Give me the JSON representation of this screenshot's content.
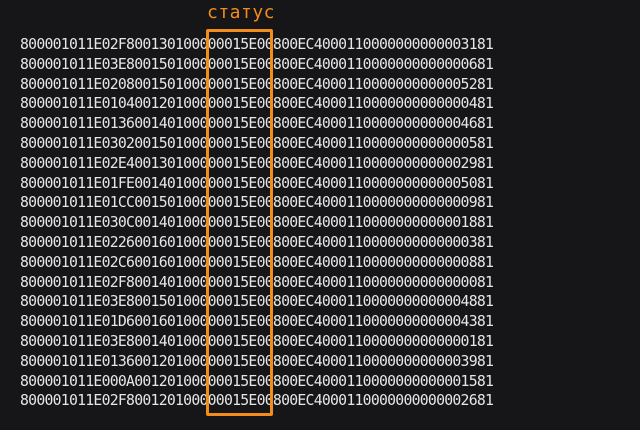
{
  "header": {
    "label": "статус"
  },
  "colors": {
    "background": "#161618",
    "text": "#e6e6e6",
    "accent": "#f28c1b"
  },
  "rows": [
    "800001011E02F800130100000015E00800EC4000110000000000003181",
    "800001011E03E800150100000015E00800EC4000110000000000000681",
    "800001011E020800150100000015E00800EC4000110000000000005281",
    "800001011E010400120100000015E00800EC4000110000000000000481",
    "800001011E013600140100000015E00800EC4000110000000000004681",
    "800001011E030200150100000015E00800EC4000110000000000000581",
    "800001011E02E400130100000015E00800EC4000110000000000002981",
    "800001011E01FE00140100000015E00800EC4000110000000000005081",
    "800001011E01CC00150100000015E00800EC4000110000000000000981",
    "800001011E030C00140100000015E00800EC4000110000000000001881",
    "800001011E022600160100000015E00800EC4000110000000000000381",
    "800001011E02C600160100000015E00800EC4000110000000000000881",
    "800001011E02F800140100000015E00800EC4000110000000000000081",
    "800001011E03E800150100000015E00800EC4000110000000000004881",
    "800001011E01D600160100000015E00800EC4000110000000000004381",
    "800001011E03E800140100000015E00800EC4000110000000000000181",
    "800001011E013600120100000015E00800EC4000110000000000003981",
    "800001011E000A00120100000015E00800EC4000110000000000001581",
    "800001011E02F800120100000015E00800EC4000110000000000002681"
  ]
}
